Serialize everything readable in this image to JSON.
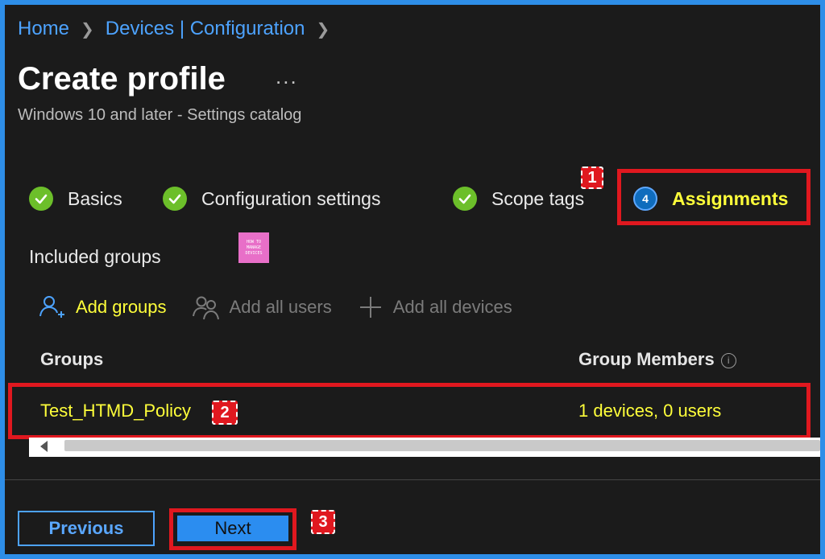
{
  "breadcrumb": {
    "home": "Home",
    "section": "Devices | Configuration"
  },
  "page": {
    "title": "Create profile",
    "more": "...",
    "subtitle": "Windows 10 and later - Settings catalog"
  },
  "steps": [
    {
      "label": "Basics",
      "status": "complete"
    },
    {
      "label": "Configuration settings",
      "status": "complete"
    },
    {
      "label": "Scope tags",
      "status": "complete"
    },
    {
      "number": "4",
      "label": "Assignments",
      "status": "active"
    }
  ],
  "included_groups": {
    "heading": "Included groups",
    "logo_text": [
      "HOW TO",
      "MANAGE",
      "DEVICES"
    ]
  },
  "actions": {
    "add_groups": "Add groups",
    "add_all_users": "Add all users",
    "add_all_devices": "Add all devices"
  },
  "table": {
    "columns": [
      "Groups",
      "Group Members"
    ],
    "info_glyph": "i",
    "rows": [
      {
        "group": "Test_HTMD_Policy",
        "members": "1 devices, 0 users"
      }
    ]
  },
  "annotations": [
    "1",
    "2",
    "3"
  ],
  "footer": {
    "previous": "Previous",
    "next": "Next"
  },
  "colors": {
    "accent": "#2e8ee8",
    "highlight_text": "#ffff3a",
    "annotation": "#e0181f",
    "success": "#6cbf2a"
  }
}
